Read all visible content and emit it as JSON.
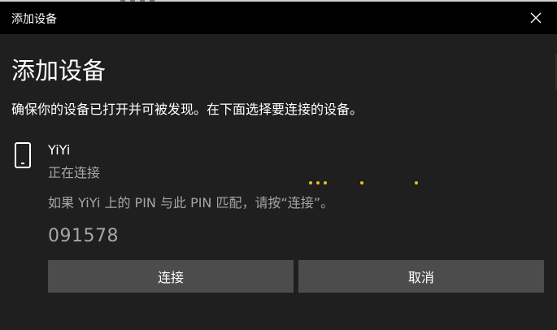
{
  "window": {
    "title": "添加设备"
  },
  "heading": "添加设备",
  "subtitle": "确保你的设备已打开并可被发现。在下面选择要连接的设备。",
  "device": {
    "icon": "phone-icon",
    "name": "YiYi",
    "status": "正在连接"
  },
  "pin": {
    "instruction": "如果 YiYi 上的 PIN 与此 PIN 匹配，请按“连接”。",
    "code": "091578"
  },
  "buttons": {
    "connect_label": "连接",
    "cancel_label": "取消"
  },
  "colors": {
    "background": "#1f1f1f",
    "titlebar": "#000000",
    "button": "#4c4c4c",
    "secondary_text": "#a6a6a6",
    "progress_accent": "#e6c018"
  }
}
